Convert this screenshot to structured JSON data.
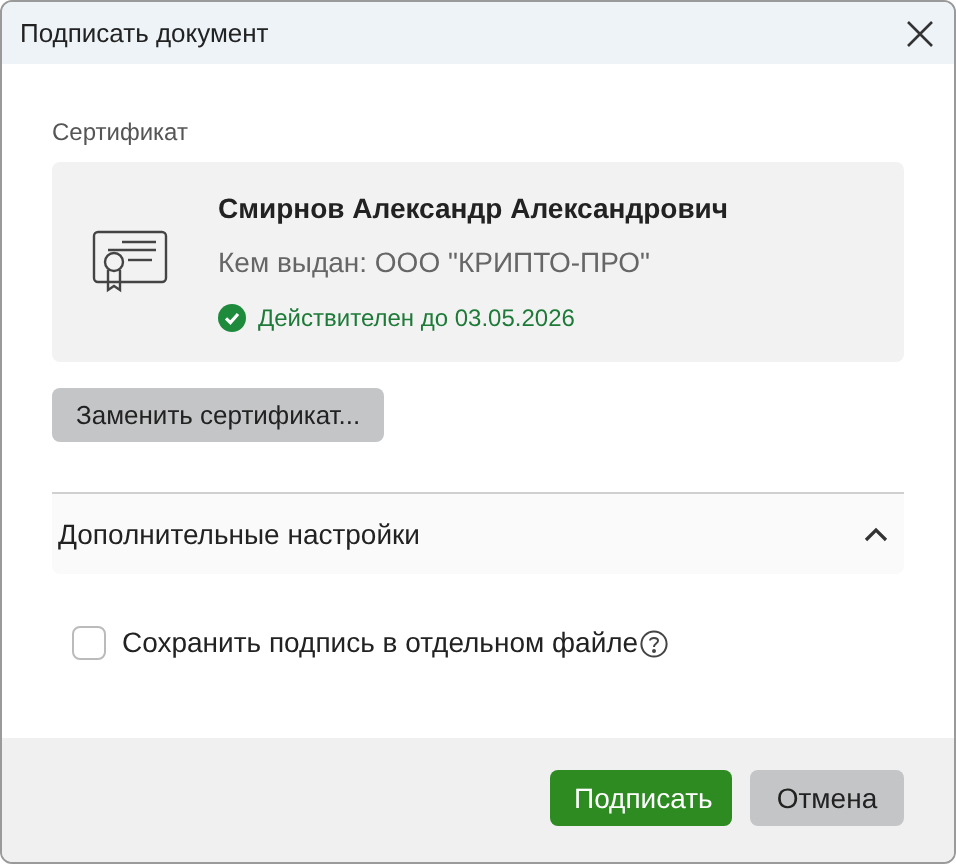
{
  "window": {
    "title": "Подписать документ"
  },
  "certificate": {
    "label": "Сертификат",
    "owner": "Смирнов Александр Александрович",
    "issuer": "Кем выдан: ООО \"КРИПТО-ПРО\"",
    "status": "Действителен до 03.05.2026",
    "valid": true,
    "replace_button": "Заменить сертификат..."
  },
  "advanced": {
    "title": "Дополнительные настройки",
    "expanded": true,
    "options": [
      {
        "label": "Сохранить подпись в отдельном файле",
        "checked": false
      }
    ]
  },
  "buttons": [
    {
      "label": "Подписать",
      "kind": "primary"
    },
    {
      "label": "Отмена",
      "kind": "secondary"
    }
  ]
}
